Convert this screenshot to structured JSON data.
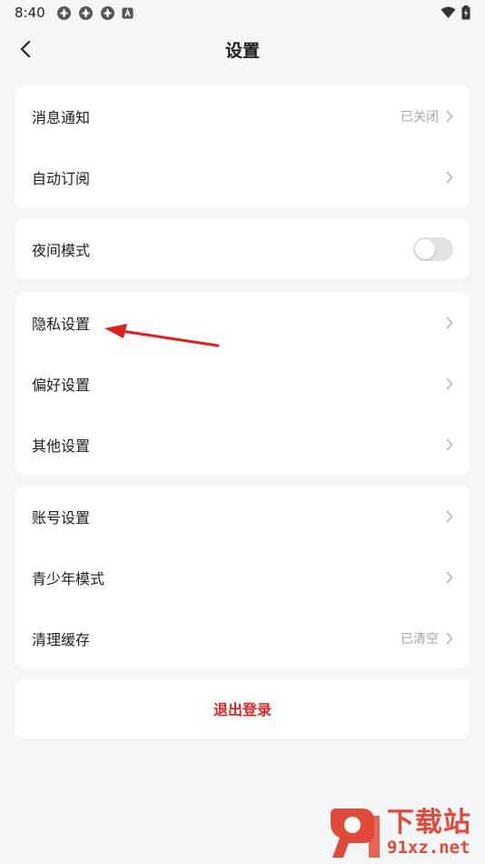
{
  "status_bar": {
    "time": "8:40"
  },
  "header": {
    "title": "设置"
  },
  "groups": [
    {
      "items": [
        {
          "label": "消息通知",
          "value": "已关闭"
        },
        {
          "label": "自动订阅"
        }
      ]
    },
    {
      "items": [
        {
          "label": "夜间模式",
          "toggle_on": false
        }
      ]
    },
    {
      "items": [
        {
          "label": "隐私设置"
        },
        {
          "label": "偏好设置"
        },
        {
          "label": "其他设置"
        }
      ]
    },
    {
      "items": [
        {
          "label": "账号设置"
        },
        {
          "label": "青少年模式"
        },
        {
          "label": "清理缓存",
          "value": "已清空"
        }
      ]
    }
  ],
  "logout": {
    "label": "退出登录"
  },
  "watermark": {
    "title": "下载站",
    "url": "91xz.net"
  },
  "colors": {
    "accent_red": "#e02424",
    "background": "#f4f5f7",
    "annotation_arrow": "#e02020"
  }
}
